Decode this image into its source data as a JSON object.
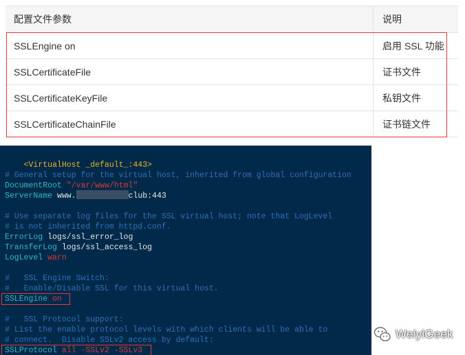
{
  "table": {
    "headers": [
      "配置文件参数",
      "说明"
    ],
    "rows": [
      [
        "SSLEngine on",
        "启用 SSL 功能"
      ],
      [
        "SSLCertificateFile",
        "证书文件"
      ],
      [
        "SSLCertificateKeyFile",
        "私钥文件"
      ],
      [
        "SSLCertificateChainFile",
        "证书链文件"
      ]
    ]
  },
  "terminal": {
    "vhost_open": "<VirtualHost _default_:443>",
    "c_general": "# General setup for the virtual host, inherited from global configuration",
    "docroot_key": "DocumentRoot",
    "docroot_val": "\"/var/www/html\"",
    "servername_key": "ServerName",
    "servername_prefix": "www.",
    "servername_suffix": "club:443",
    "c_log1": "# Use separate log files for the SSL virtual host; note that LogLevel",
    "c_log2": "# is not inherited from httpd.conf.",
    "errorlog_key": "ErrorLog",
    "errorlog_val": "logs/ssl_error_log",
    "transferlog_key": "TransferLog",
    "transferlog_val": "logs/ssl_access_log",
    "loglevel_key": "LogLevel",
    "loglevel_val": "warn",
    "c_switch1": "#   SSL Engine Switch:",
    "c_switch2": "#   Enable/Disable SSL for this virtual host.",
    "sslengine_key": "SSLEngine",
    "sslengine_val": "on",
    "c_proto1": "#   SSL Protocol support:",
    "c_proto2": "# List the enable protocol levels with which clients will be able to",
    "c_proto3": "# connect.  Disable SSLv2 access by default:",
    "sslprotocol_key": "SSLProtocol",
    "sslprotocol_val": "all -SSLv2 -SSLv3"
  },
  "watermark": {
    "text": "WeiyiGeek",
    "icon": "wechat-icon"
  },
  "colors": {
    "terminal_bg": "#012a4a",
    "comment": "#2f6fb8",
    "directive": "#33b8c4",
    "value_string": "#d23a3a",
    "highlight_box": "#e4393c"
  }
}
